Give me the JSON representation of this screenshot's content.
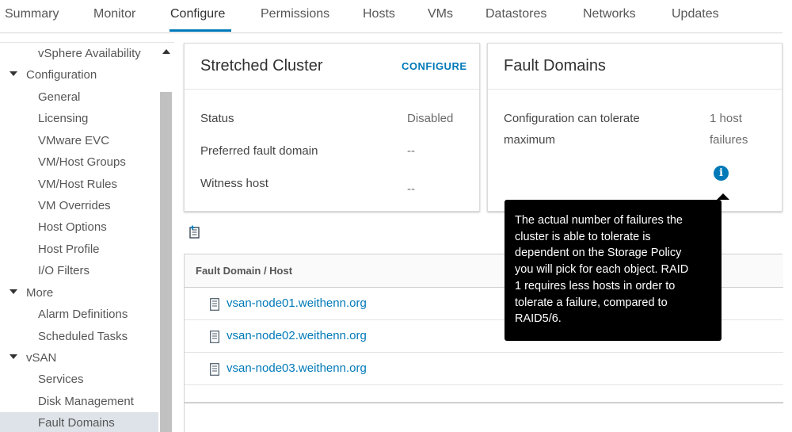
{
  "tabs": [
    {
      "label": "Summary"
    },
    {
      "label": "Monitor"
    },
    {
      "label": "Configure"
    },
    {
      "label": "Permissions"
    },
    {
      "label": "Hosts"
    },
    {
      "label": "VMs"
    },
    {
      "label": "Datastores"
    },
    {
      "label": "Networks"
    },
    {
      "label": "Updates"
    }
  ],
  "active_tab": "Configure",
  "sidebar": {
    "items": [
      {
        "label": "vSphere Availability"
      },
      {
        "label": "Configuration"
      },
      {
        "label": "General"
      },
      {
        "label": "Licensing"
      },
      {
        "label": "VMware EVC"
      },
      {
        "label": "VM/Host Groups"
      },
      {
        "label": "VM/Host Rules"
      },
      {
        "label": "VM Overrides"
      },
      {
        "label": "Host Options"
      },
      {
        "label": "Host Profile"
      },
      {
        "label": "I/O Filters"
      },
      {
        "label": "More"
      },
      {
        "label": "Alarm Definitions"
      },
      {
        "label": "Scheduled Tasks"
      },
      {
        "label": "vSAN"
      },
      {
        "label": "Services"
      },
      {
        "label": "Disk Management"
      },
      {
        "label": "Fault Domains"
      }
    ],
    "selected": "Fault Domains"
  },
  "stretched_cluster": {
    "title": "Stretched Cluster",
    "configure_label": "CONFIGURE",
    "rows": [
      {
        "label": "Status",
        "value": "Disabled"
      },
      {
        "label": "Preferred fault domain",
        "value": "--"
      },
      {
        "label": "Witness host",
        "value": "--"
      }
    ]
  },
  "fault_domains_card": {
    "title": "Fault Domains",
    "tolerate_label_line1": "Configuration can tolerate",
    "tolerate_label_line2": "maximum",
    "tolerate_value_line1": "1 host",
    "tolerate_value_line2": "failures",
    "info_icon": "i"
  },
  "tooltip": {
    "lines": [
      "The actual number of failures the",
      "cluster is able to tolerate is",
      "dependent on the Storage Policy",
      "you will pick for each object. RAID",
      "1 requires less hosts in order to",
      "tolerate a failure, compared to",
      "RAID5/6."
    ]
  },
  "table": {
    "header": "Fault Domain / Host",
    "rows": [
      {
        "host": "vsan-node01.weithenn.org"
      },
      {
        "host": "vsan-node02.weithenn.org"
      },
      {
        "host": "vsan-node03.weithenn.org"
      }
    ]
  },
  "colors": {
    "accent": "#0079b8",
    "selected_bg": "#dde3e8",
    "tooltip_bg": "#000000"
  },
  "icons": {
    "add": "add-fault-domain-icon",
    "host": "host-document-icon",
    "info": "info-icon"
  }
}
